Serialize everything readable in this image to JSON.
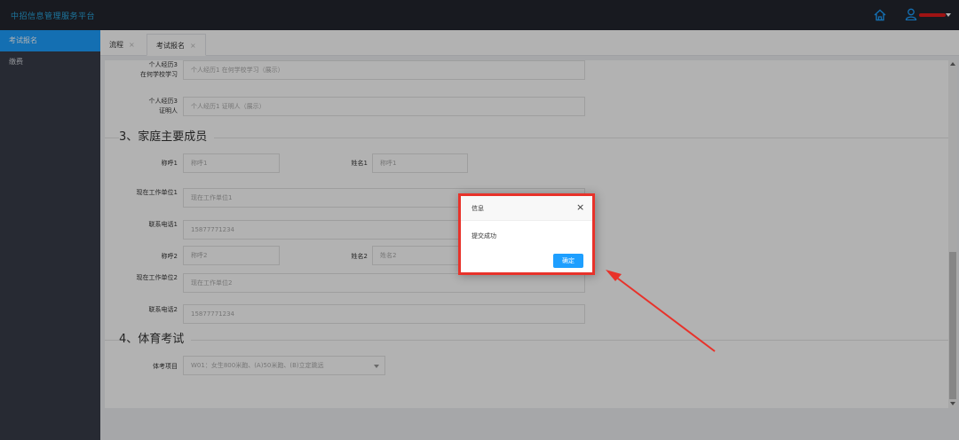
{
  "app": {
    "title": "中招信息管理服务平台"
  },
  "header": {
    "home_icon": "home-icon",
    "user_icon": "user-icon",
    "user_name_redacted": true
  },
  "sidebar": {
    "items": [
      {
        "label": "考试报名",
        "active": true
      },
      {
        "label": "缴费",
        "active": false
      }
    ]
  },
  "tabs": [
    {
      "label": "流程",
      "close": "×",
      "active": false
    },
    {
      "label": "考试报名",
      "close": "×",
      "active": true
    }
  ],
  "form": {
    "resume3_school": {
      "label_line1": "个人经历3",
      "label_line2": "在何学校学习",
      "placeholder": "个人经历1 在何学校学习（展示）"
    },
    "resume3_witness": {
      "label_line1": "个人经历3",
      "label_line2": "证明人",
      "placeholder": "个人经历1 证明人（展示）"
    },
    "section_family": "3、家庭主要成员",
    "title1": {
      "label": "称呼1",
      "placeholder": "称呼1"
    },
    "name1": {
      "label": "姓名1",
      "placeholder": "称呼1"
    },
    "work1": {
      "label": "现在工作单位1",
      "placeholder": "现在工作单位1"
    },
    "phone1": {
      "label": "联系电话1",
      "placeholder": "15877771234"
    },
    "title2": {
      "label": "称呼2",
      "placeholder": "称呼2"
    },
    "name2": {
      "label": "姓名2",
      "placeholder": "姓名2"
    },
    "work2": {
      "label": "现在工作单位2",
      "placeholder": "现在工作单位2"
    },
    "phone2": {
      "label": "联系电话2",
      "placeholder": "15877771234"
    },
    "section_sports": "4、体育考试",
    "sports_item": {
      "label": "体考项目",
      "value": "W01：女生800米跑、(A)50米跑、(B)立定跳远"
    }
  },
  "dialog": {
    "title": "信息",
    "close": "×",
    "message": "提交成功",
    "ok": "确定"
  },
  "colors": {
    "topbar": "#23262e",
    "sidebar": "#393d49",
    "accent": "#1e9fff",
    "annotation": "#e8322a",
    "brand": "#2aa7e0"
  }
}
